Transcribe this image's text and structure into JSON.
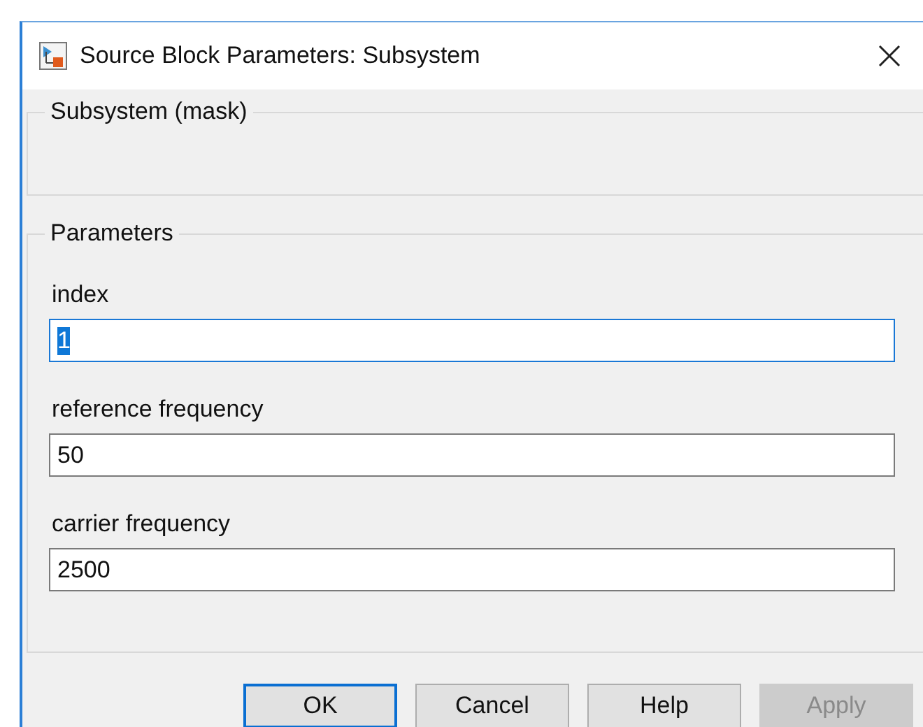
{
  "window": {
    "title": "Source Block Parameters: Subsystem"
  },
  "mask_group": {
    "title": "Subsystem (mask)"
  },
  "parameters": {
    "title": "Parameters",
    "fields": [
      {
        "label": "index",
        "value": "1",
        "focused": true
      },
      {
        "label": "reference frequency",
        "value": "50",
        "focused": false
      },
      {
        "label": "carrier frequency",
        "value": "2500",
        "focused": false
      }
    ]
  },
  "buttons": [
    {
      "label": "OK",
      "default": true,
      "disabled": false
    },
    {
      "label": "Cancel",
      "default": false,
      "disabled": false
    },
    {
      "label": "Help",
      "default": false,
      "disabled": false
    },
    {
      "label": "Apply",
      "default": false,
      "disabled": true
    }
  ]
}
